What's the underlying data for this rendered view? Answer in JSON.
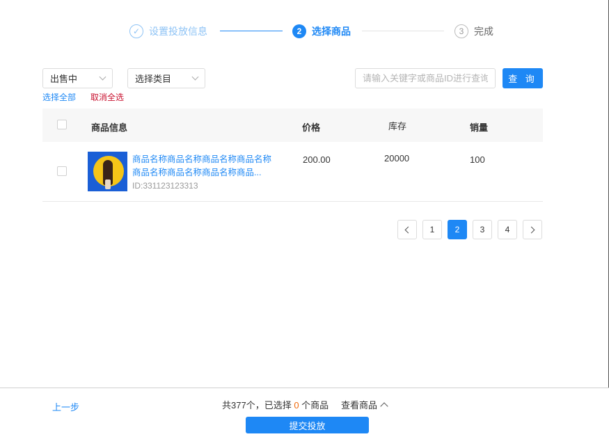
{
  "steps": {
    "step1": {
      "icon": "✓",
      "label": "设置投放信息"
    },
    "step2": {
      "number": "2",
      "label": "选择商品"
    },
    "step3": {
      "number": "3",
      "label": "完成"
    }
  },
  "filters": {
    "status_select": "出售中",
    "category_select": "选择类目",
    "search_placeholder": "请输入关键字或商品ID进行查询",
    "search_button": "查 询",
    "select_all": "选择全部",
    "clear_all": "取消全选"
  },
  "table": {
    "headers": {
      "info": "商品信息",
      "price": "价格",
      "stock": "库存",
      "sales": "销量"
    },
    "rows": [
      {
        "name": "商品名称商品名称商品名称商品名称商品名称商品名称商品名称商品...",
        "id": "ID:331123123313",
        "price": "200.00",
        "stock": "20000",
        "sales": "100"
      }
    ]
  },
  "pagination": {
    "pages": [
      "1",
      "2",
      "3",
      "4"
    ],
    "current": "2"
  },
  "footer": {
    "prev": "上一步",
    "summary_prefix": "共377个，已选择 ",
    "selected_count": "0",
    "summary_suffix": " 个商品",
    "view_goods": "查看商品",
    "submit": "提交投放"
  },
  "colors": {
    "primary": "#1e88f5",
    "danger": "#c8102e",
    "highlight": "#f06a0c"
  }
}
